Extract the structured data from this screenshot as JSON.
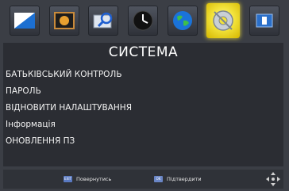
{
  "screen": {
    "title": "СИСТЕМА"
  },
  "icon_bar": {
    "icons": [
      {
        "name": "picture-settings-icon"
      },
      {
        "name": "image-settings-icon"
      },
      {
        "name": "channel-search-icon"
      },
      {
        "name": "time-settings-icon"
      },
      {
        "name": "language-settings-icon"
      },
      {
        "name": "system-settings-icon",
        "active": true
      },
      {
        "name": "usb-media-icon"
      }
    ],
    "accent_color": "#f2e23a"
  },
  "menu": {
    "items": [
      {
        "label": "БАТЬКІВСЬКИЙ КОНТРОЛЬ"
      },
      {
        "label": "ПАРОЛЬ"
      },
      {
        "label": "ВІДНОВИТИ НАЛАШТУВАННЯ"
      },
      {
        "label": "Інформація"
      },
      {
        "label": "ОНОВЛЕННЯ ПЗ"
      }
    ]
  },
  "footer": {
    "back_key": "EXIT",
    "back_label": "Повернутись",
    "ok_key": "OK",
    "ok_label": "Підтвердити"
  }
}
